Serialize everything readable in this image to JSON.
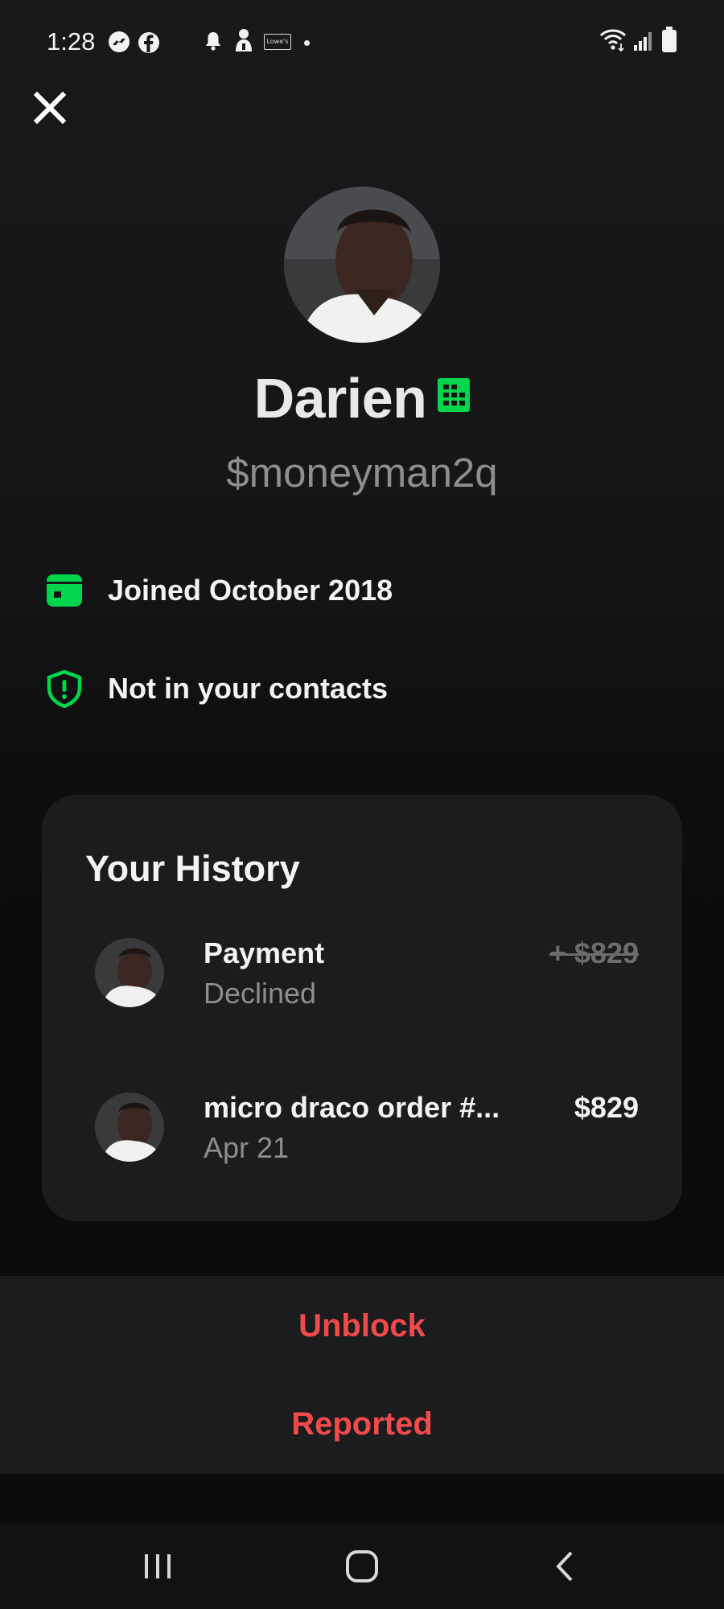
{
  "status_bar": {
    "time": "1:28",
    "icons": [
      "messenger-icon",
      "facebook-icon",
      "bell-icon",
      "cash-app-icon",
      "lowes-icon",
      "notification-dot",
      "wifi-icon",
      "signal-icon",
      "battery-icon"
    ],
    "lowes_label": "Lowe's"
  },
  "profile": {
    "display_name": "Darien",
    "cashtag": "$moneyman2q",
    "business_icon": "business-building-icon",
    "accent_color": "#00d54b"
  },
  "info": {
    "joined": "Joined October 2018",
    "contacts": "Not in your contacts"
  },
  "history": {
    "title": "Your History",
    "items": [
      {
        "title": "Payment",
        "subtitle": "Declined",
        "amount": "+ $829",
        "status": "declined"
      },
      {
        "title": "micro draco order #...",
        "subtitle": "Apr 21",
        "amount": "$829",
        "status": "completed"
      }
    ]
  },
  "actions": {
    "unblock": "Unblock",
    "reported": "Reported",
    "color": "#f24a4a"
  },
  "nav": [
    "recent-apps-icon",
    "home-icon",
    "back-icon"
  ]
}
